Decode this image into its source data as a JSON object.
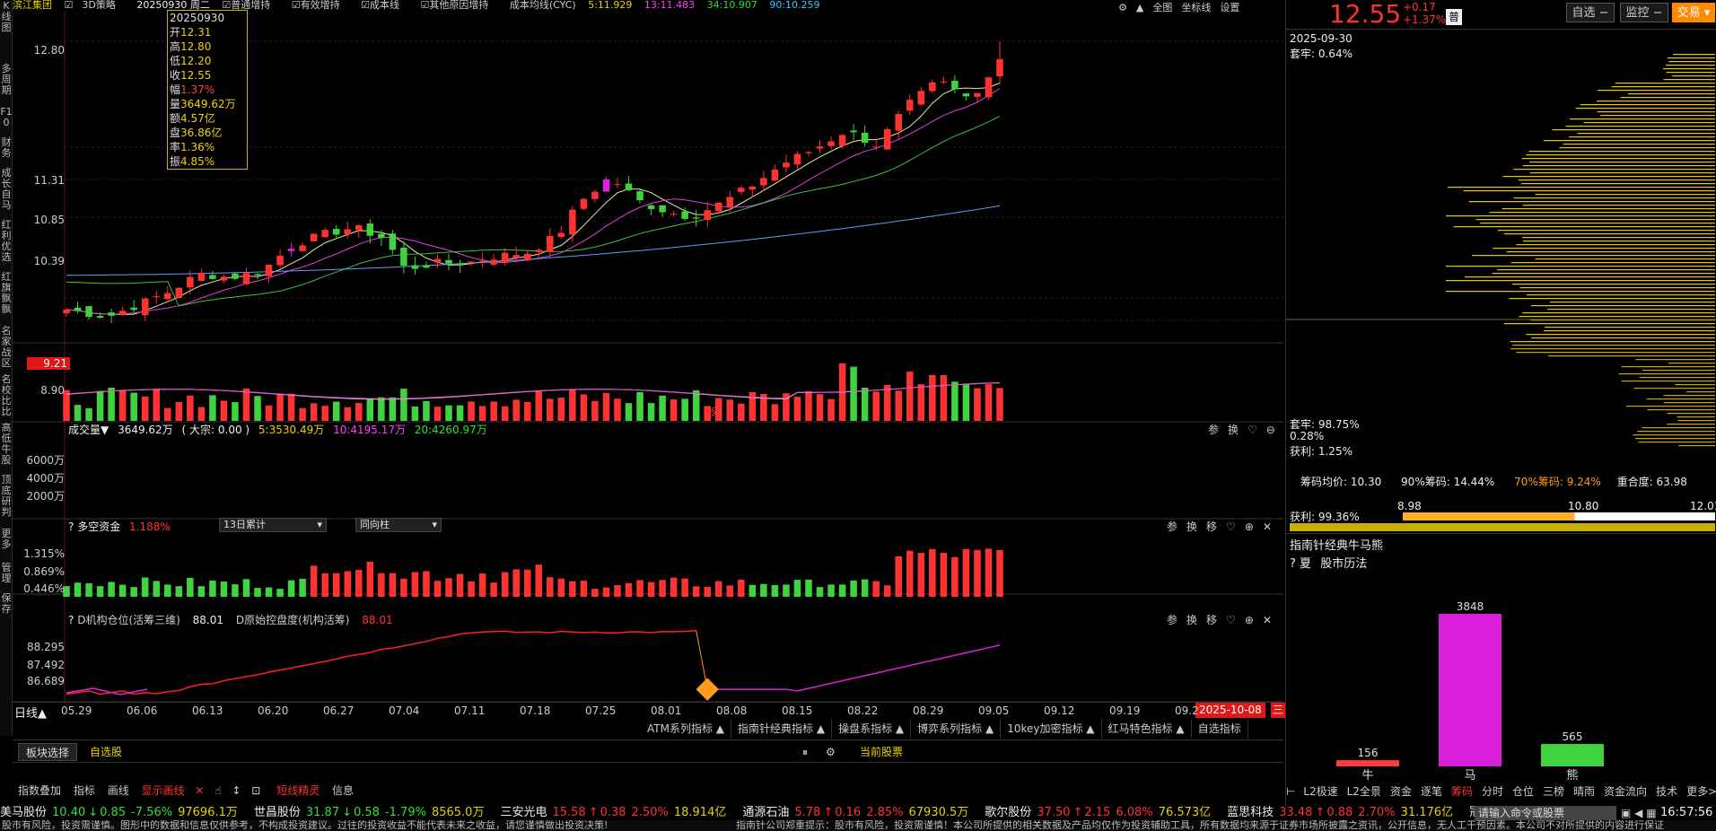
{
  "colors": {
    "up": "#ff3232",
    "down": "#3fd33f",
    "mag": "#e01ee0",
    "ma5": "#e8e8a0",
    "ma10": "#e040e0",
    "ma20": "#40c040",
    "ma60": "#5aa0ff",
    "bg": "#000000"
  },
  "left_sidebar": [
    {
      "label": "K线图"
    },
    {
      "label": "多周期"
    },
    {
      "label": "F10"
    },
    {
      "label": "财务"
    },
    {
      "label": "成长自马"
    },
    {
      "label": "红利优选"
    },
    {
      "label": "红旗飘飘"
    },
    {
      "label": "名家战区"
    },
    {
      "label": "名校比比"
    },
    {
      "label": "高低牛股"
    },
    {
      "label": "顶底研判"
    },
    {
      "label": "更多"
    },
    {
      "label": "管理"
    },
    {
      "label": "保存"
    }
  ],
  "topbar": {
    "stock_name": "滨江集团",
    "strategy": "3D策略",
    "date_week": "20250930 周二",
    "opt1": "普通增持",
    "opt2": "有效增持",
    "opt3": "成本线",
    "opt4": "其他原因增持",
    "cost": "成本均线(CYC)",
    "c5": "5:11.929",
    "c13": "13:11.483",
    "c34": "34:10.907",
    "c90": "90:10.259",
    "right1": "全图",
    "right2": "坐标线",
    "right3": "设置"
  },
  "tooltip": {
    "date": "20250930",
    "rows": [
      {
        "k": "开",
        "v": "12.31"
      },
      {
        "k": "高",
        "v": "12.80"
      },
      {
        "k": "低",
        "v": "12.20"
      },
      {
        "k": "收",
        "v": "12.55"
      },
      {
        "k": "幅",
        "v": "1.37%"
      },
      {
        "k": "量",
        "v": "3649.62万"
      },
      {
        "k": "额",
        "v": "4.57亿"
      },
      {
        "k": "盘",
        "v": "36.86亿"
      },
      {
        "k": "率",
        "v": "1.36%"
      },
      {
        "k": "振",
        "v": "4.85%"
      }
    ]
  },
  "price_axis": [
    "12.80",
    "11.31",
    "10.85",
    "10.39",
    "9.21",
    "8.90"
  ],
  "current_price_tag": "9.21",
  "volume": {
    "title": "成交量▼",
    "value": "3649.62万",
    "bulk": "( 大宗: 0.00 )",
    "ma5": "5:3530.49万",
    "ma10": "10:4195.17万",
    "ma20": "20:4260.97万",
    "ticks": [
      "6000万",
      "4000万",
      "2000万"
    ]
  },
  "fund": {
    "title": "多空资金",
    "value": "1.188%",
    "sel1": "13日累计",
    "sel2": "同向柱",
    "ticks": [
      "1.315%",
      "0.869%",
      "0.446%"
    ]
  },
  "inst": {
    "title": "D机构仓位(活筹三维)",
    "v1": "88.01",
    "title2": "D原始控盘度(机构活筹)",
    "v2": "88.01",
    "ticks": [
      "88.295",
      "87.492",
      "86.689"
    ]
  },
  "date_axis": {
    "label": "日线▲",
    "dates": [
      "05.29",
      "06.06",
      "06.13",
      "06.20",
      "06.27",
      "07.04",
      "07.11",
      "07.18",
      "07.25",
      "08.01",
      "08.08",
      "08.15",
      "08.22",
      "08.29",
      "09.05",
      "09.12",
      "09.19",
      "09.2"
    ],
    "current": "2025-10-08",
    "mark": "三"
  },
  "indicator_tabs": [
    "ATM系列指标",
    "指南针经典指标",
    "操盘系指标",
    "博弈系列指标",
    "10key加密指标",
    "红马特色指标",
    "自选指标"
  ],
  "bottom_tabs": {
    "block": "板块选择",
    "self": "自选股",
    "current": "当前股票"
  },
  "bottom_tools": [
    "指数叠加",
    "指标",
    "画线",
    "显示画线",
    "短线精灵",
    "信息"
  ],
  "panel_icons": {
    "param": "参",
    "swap": "换",
    "move": "移"
  },
  "quote": {
    "price": "12.55",
    "chg": "+0.17",
    "pct": "+1.37%",
    "badge": "普",
    "b1": "自选",
    "b2": "监控",
    "b3": "交易"
  },
  "chips": {
    "date": "2025-09-30",
    "top": "套牢: 0.64%",
    "bot1": "套牢: 98.75%",
    "bot1b": "0.28%",
    "bot2": "获利: 1.25%",
    "avg": "筹码均价: 10.30",
    "p90": "90%筹码: 14.44%",
    "p70": "70%筹码: 9.24%",
    "overlap": "重合度: 63.98",
    "profit": "获利: 99.36%",
    "s1": "8.98",
    "s2": "10.80",
    "s3": "12.01"
  },
  "bull_bear": {
    "title": "指南针经典牛马熊",
    "summer": "夏",
    "history": "股市历法",
    "bars": [
      {
        "label": "牛",
        "value": 156,
        "color": "#ff3b3b"
      },
      {
        "label": "马",
        "value": 3848,
        "color": "#d81ed8"
      },
      {
        "label": "熊",
        "value": 565,
        "color": "#3fd33f"
      }
    ]
  },
  "right_tabs": [
    "L2极速",
    "L2全景",
    "资金",
    "逐笔",
    "筹码",
    "分时",
    "仓位",
    "三榜",
    "晴雨",
    "资金流向",
    "技术",
    "更多>>"
  ],
  "ticker": [
    {
      "name": "美马股份",
      "p": "10.40",
      "c": "0.85",
      "pct": "-7.56%",
      "amt": "97696.1万",
      "dir": "down"
    },
    {
      "name": "世昌股份",
      "p": "31.87",
      "c": "0.58",
      "pct": "-1.79%",
      "amt": "8565.0万",
      "dir": "down"
    },
    {
      "name": "三安光电",
      "p": "15.58",
      "c": "0.38",
      "pct": "2.50%",
      "amt": "18.914亿",
      "dir": "up"
    },
    {
      "name": "通源石油",
      "p": "5.78",
      "c": "0.16",
      "pct": "2.85%",
      "amt": "67930.5万",
      "dir": "up"
    },
    {
      "name": "歌尔股份",
      "p": "37.50",
      "c": "2.15",
      "pct": "6.08%",
      "amt": "76.573亿",
      "dir": "up"
    },
    {
      "name": "蓝思科技",
      "p": "33.48",
      "c": "0.88",
      "pct": "2.70%",
      "amt": "31.176亿",
      "dir": "up"
    },
    {
      "name": "冠捷科技",
      "p": "",
      "c": "",
      "pct": "",
      "amt": "",
      "dir": "up"
    }
  ],
  "cmd_placeholder": "请输入命令或股票",
  "clock": "16:57:56",
  "status_left": "股市有风险，投资需谨慎。图形中的数据和信息仅供参考，不构成投资建议。过往的投资收益不能代表未来之收益，请您谨慎做出投资决策!",
  "status_right": "指南针公司郑重提示：股市有风险，投资需谨慎！本公司所提供的相关数据及产品均仅作为投资辅助工具，所有数据均来源于证券市场所披露之资讯，公开信息，无人工干预因素。本公司不对所提供的内容进行保证"
}
